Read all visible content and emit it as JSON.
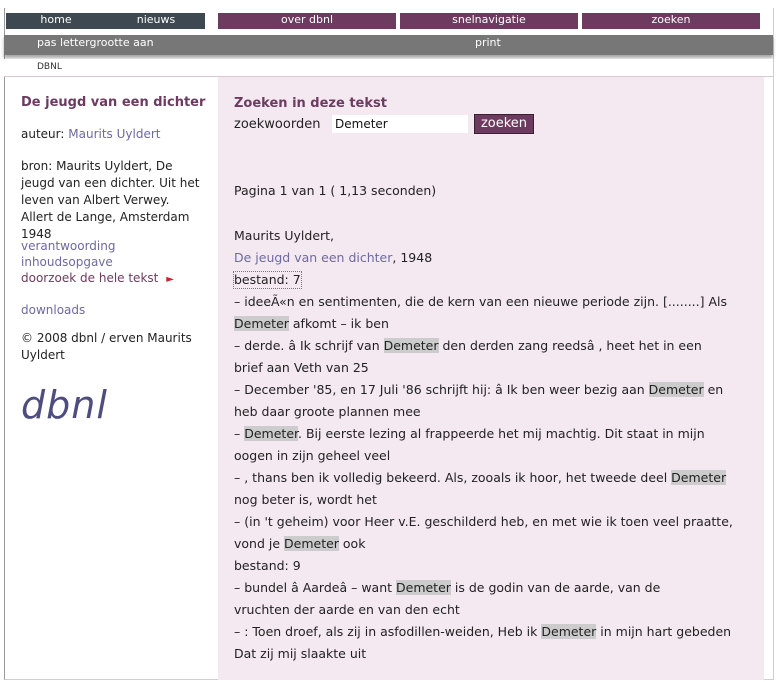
{
  "nav": {
    "home": "home",
    "nieuws": "nieuws",
    "over": "over dbnl",
    "snel": "snelnavigatie",
    "zoeken": "zoeken"
  },
  "toolbar": {
    "font_size": "pas lettergrootte aan",
    "print": "print"
  },
  "breadcrumb": "DBNL",
  "sidebar": {
    "title": "De jeugd van een dichter",
    "author_label": "auteur:",
    "author": "Maurits Uyldert",
    "source": "bron: Maurits Uyldert, De jeugd van een dichter. Uit het leven van Albert Verwey. Allert de Lange, Amsterdam 1948",
    "link_verantwoording": "verantwoording",
    "link_inhoud": "inhoudsopgave",
    "link_doorzoek": "doorzoek de hele tekst",
    "arrow": "►",
    "link_downloads": "downloads",
    "copyright": "© 2008 dbnl / erven Maurits Uyldert",
    "logo": "dbnl"
  },
  "search": {
    "heading": "Zoeken in deze tekst",
    "label": "zoekwoorden",
    "value": "Demeter",
    "button": "zoeken"
  },
  "results": {
    "pagination": "Pagina 1 van 1 ( 1,13 seconden)",
    "author": "Maurits Uyldert,",
    "book_title": "De jeugd van een dichter",
    "year": ", 1948",
    "file1": "bestand: 7",
    "file2": "bestand: 9",
    "term": "Demeter",
    "l1a": "–  ideeÃ«n en sentimenten, die de kern van een nieuwe periode zijn. [........] Als",
    "l2b": " afkomt – ik ben",
    "l3a": "–  derde. â     Ik schrijf van ",
    "l3b": " den derden zang reedsâ     , heet het in een",
    "l4": "brief aan Veth van 25",
    "l5a": "–  December '85, en 17 Juli '86 schrijft hij: â     Ik ben weer bezig aan ",
    "l5b": " en",
    "l6": "heb daar groote plannen mee",
    "l7a": "–  ",
    "l7b": ". Bij eerste lezing al frappeerde het mij machtig. Dit staat in mijn",
    "l8": "oogen in zijn geheel veel",
    "l9a": "–  , thans ben ik volledig bekeerd. Als, zooals ik hoor, het tweede deel ",
    "l10": "nog beter is, wordt het",
    "l11": "–  (in 't geheim) voor Heer v.E. geschilderd heb, en met wie ik toen veel praatte,",
    "l12a": "vond je ",
    "l12b": " ook",
    "l13a": "–  bundel â     Aardeâ      – want ",
    "l13b": " is de godin van de aarde, van de",
    "l14": "vruchten der aarde en van den echt",
    "l15a": "–  : Toen droef, als zij in asfodillen-weiden, Heb ik ",
    "l15b": " in mijn hart gebeden",
    "l16": "Dat zij mij slaakte uit"
  }
}
